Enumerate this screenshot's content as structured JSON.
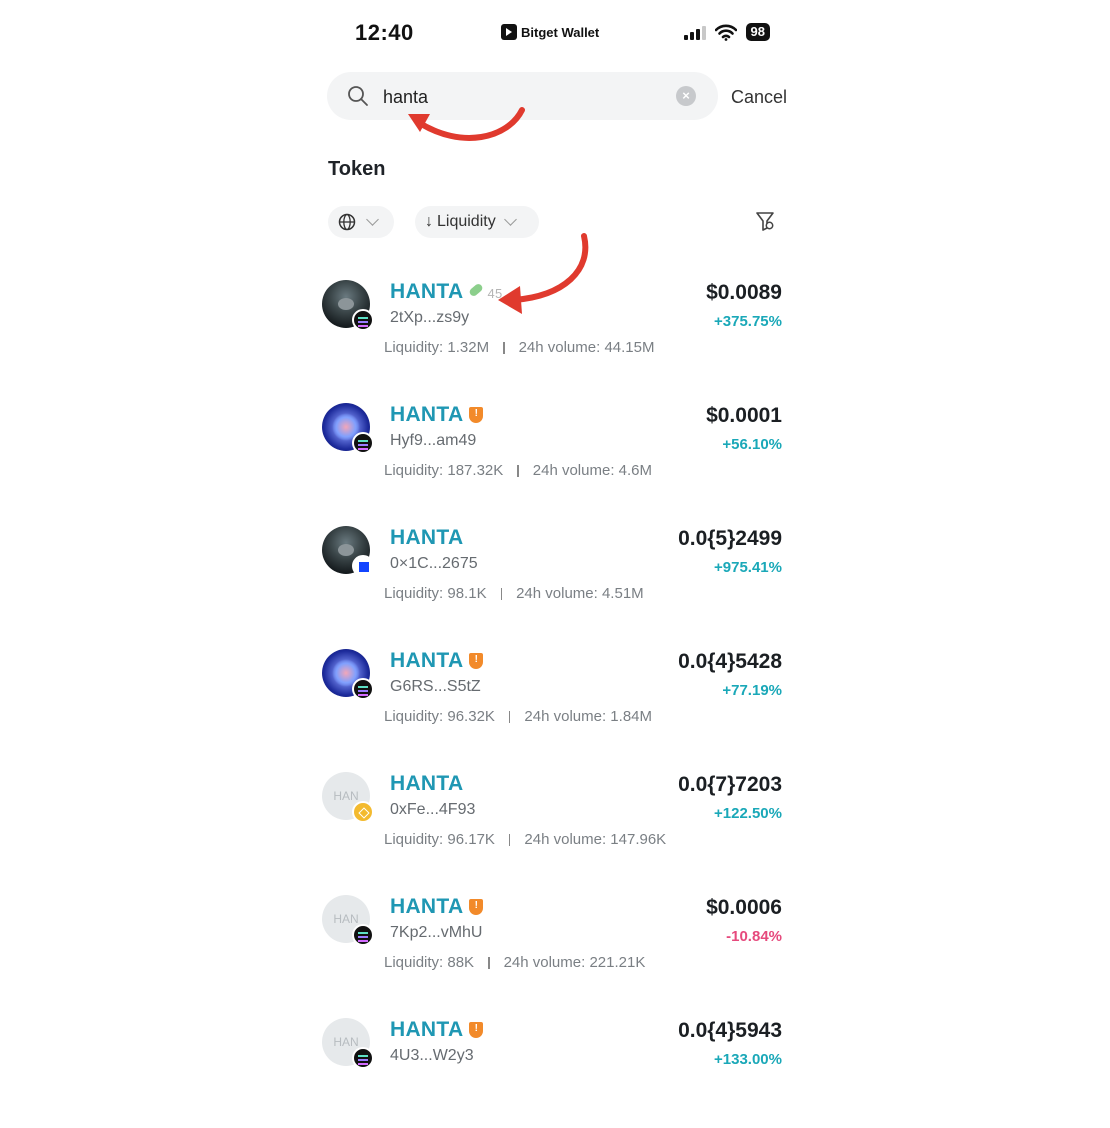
{
  "status_bar": {
    "time": "12:40",
    "carrier": "Bitget Wallet",
    "battery": "98"
  },
  "search": {
    "value": "hanta",
    "placeholder": "",
    "cancel_label": "Cancel"
  },
  "section_title": "Token",
  "filters": {
    "network_icon": "globe-icon",
    "sort_label": "Liquidity",
    "sort_arrow": "↓"
  },
  "tokens": [
    {
      "name": "HANTA",
      "badge": "pill",
      "extra": "45",
      "address": "2tXp...zs9y",
      "liquidity": "Liquidity: 1.32M",
      "volume": "24h volume: 44.15M",
      "price": "$0.0089",
      "change": "+375.75%",
      "direction": "up",
      "avatar": "rat",
      "chain": "sol"
    },
    {
      "name": "HANTA",
      "badge": "shield",
      "extra": "",
      "address": "Hyf9...am49",
      "liquidity": "Liquidity: 187.32K",
      "volume": "24h volume: 4.6M",
      "price": "$0.0001",
      "change": "+56.10%",
      "direction": "up",
      "avatar": "virus",
      "chain": "sol"
    },
    {
      "name": "HANTA",
      "badge": "",
      "extra": "",
      "address": "0×1C...2675",
      "liquidity": "Liquidity: 98.1K",
      "volume": "24h volume: 4.51M",
      "price": "0.0{5}2499",
      "change": "+975.41%",
      "direction": "up",
      "avatar": "rat",
      "chain": "base"
    },
    {
      "name": "HANTA",
      "badge": "shield",
      "extra": "",
      "address": "G6RS...S5tZ",
      "liquidity": "Liquidity: 96.32K",
      "volume": "24h volume: 1.84M",
      "price": "0.0{4}5428",
      "change": "+77.19%",
      "direction": "up",
      "avatar": "virus",
      "chain": "sol"
    },
    {
      "name": "HANTA",
      "badge": "",
      "extra": "",
      "address": "0xFe...4F93",
      "liquidity": "Liquidity: 96.17K",
      "volume": "24h volume: 147.96K",
      "price": "0.0{7}7203",
      "change": "+122.50%",
      "direction": "up",
      "avatar": "plain",
      "avatar_text": "HAN",
      "chain": "bnb"
    },
    {
      "name": "HANTA",
      "badge": "shield",
      "extra": "",
      "address": "7Kp2...vMhU",
      "liquidity": "Liquidity: 88K",
      "volume": "24h volume: 221.21K",
      "price": "$0.0006",
      "change": "-10.84%",
      "direction": "down",
      "avatar": "plain",
      "avatar_text": "HAN",
      "chain": "sol"
    },
    {
      "name": "HANTA",
      "badge": "shield",
      "extra": "",
      "address": "4U3...W2y3",
      "liquidity": "",
      "volume": "",
      "price": "0.0{4}5943",
      "change": "+133.00%",
      "direction": "up",
      "avatar": "plain",
      "avatar_text": "HAN",
      "chain": "sol"
    }
  ],
  "colors": {
    "name": "#1f97b3",
    "up": "#1aa8b8",
    "down": "#e64a7d",
    "annotation_arrow": "#e03a2e"
  }
}
